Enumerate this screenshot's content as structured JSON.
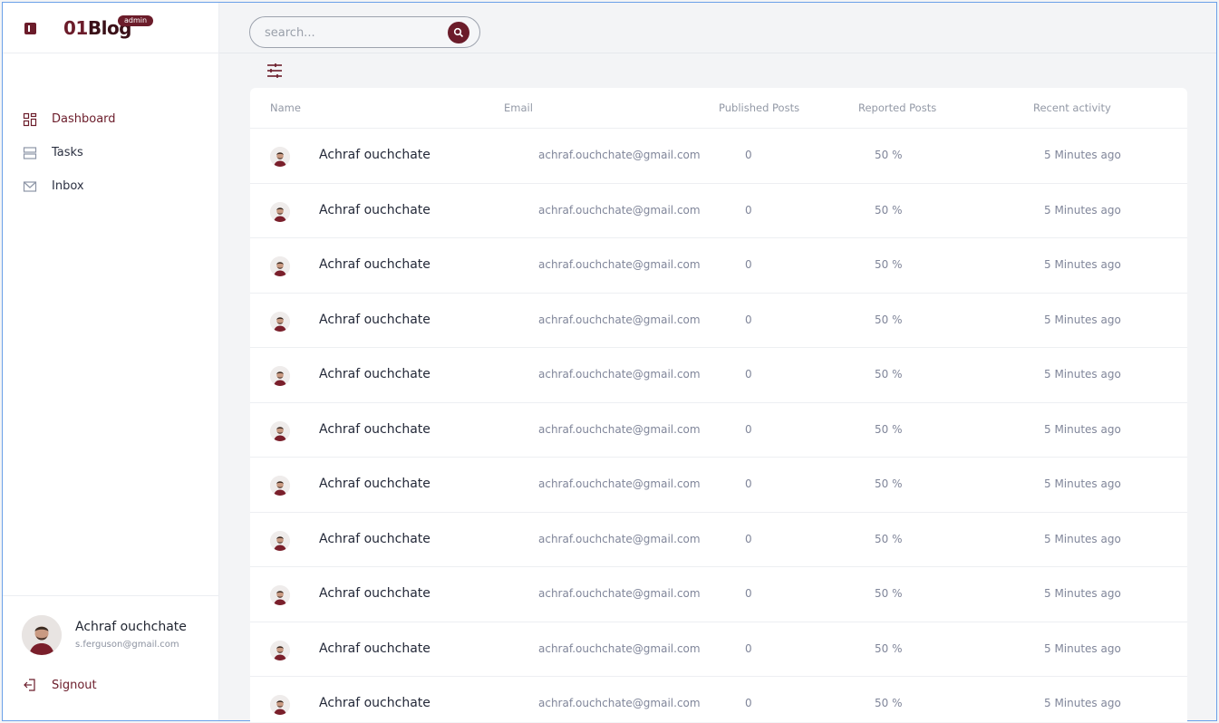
{
  "brand": {
    "logo_strong": "01",
    "logo_rest": "Blog",
    "badge": "admin"
  },
  "sidebar": {
    "items": [
      {
        "label": "Dashboard",
        "icon": "dashboard-icon"
      },
      {
        "label": "Tasks",
        "icon": "tasks-icon"
      },
      {
        "label": "Inbox",
        "icon": "inbox-icon"
      }
    ]
  },
  "user": {
    "name": "Achraf ouchchate",
    "email": "s.ferguson@gmail.com"
  },
  "signout": {
    "label": "Signout"
  },
  "search": {
    "placeholder": "search..."
  },
  "table": {
    "headers": [
      "Name",
      "Email",
      "Published Posts",
      "Reported Posts",
      "Recent activity"
    ],
    "rows": [
      {
        "name": "Achraf ouchchate",
        "email": "achraf.ouchchate@gmail.com",
        "published": "0",
        "reported": "50 %",
        "activity": "5 Minutes ago"
      },
      {
        "name": "Achraf ouchchate",
        "email": "achraf.ouchchate@gmail.com",
        "published": "0",
        "reported": "50 %",
        "activity": "5 Minutes ago"
      },
      {
        "name": "Achraf ouchchate",
        "email": "achraf.ouchchate@gmail.com",
        "published": "0",
        "reported": "50 %",
        "activity": "5 Minutes ago"
      },
      {
        "name": "Achraf ouchchate",
        "email": "achraf.ouchchate@gmail.com",
        "published": "0",
        "reported": "50 %",
        "activity": "5 Minutes ago"
      },
      {
        "name": "Achraf ouchchate",
        "email": "achraf.ouchchate@gmail.com",
        "published": "0",
        "reported": "50 %",
        "activity": "5 Minutes ago"
      },
      {
        "name": "Achraf ouchchate",
        "email": "achraf.ouchchate@gmail.com",
        "published": "0",
        "reported": "50 %",
        "activity": "5 Minutes ago"
      },
      {
        "name": "Achraf ouchchate",
        "email": "achraf.ouchchate@gmail.com",
        "published": "0",
        "reported": "50 %",
        "activity": "5 Minutes ago"
      },
      {
        "name": "Achraf ouchchate",
        "email": "achraf.ouchchate@gmail.com",
        "published": "0",
        "reported": "50 %",
        "activity": "5 Minutes ago"
      },
      {
        "name": "Achraf ouchchate",
        "email": "achraf.ouchchate@gmail.com",
        "published": "0",
        "reported": "50 %",
        "activity": "5 Minutes ago"
      },
      {
        "name": "Achraf ouchchate",
        "email": "achraf.ouchchate@gmail.com",
        "published": "0",
        "reported": "50 %",
        "activity": "5 Minutes ago"
      },
      {
        "name": "Achraf ouchchate",
        "email": "achraf.ouchchate@gmail.com",
        "published": "0",
        "reported": "50 %",
        "activity": "5 Minutes ago"
      }
    ]
  },
  "colors": {
    "accent": "#6b1c2a",
    "background": "#f3f4f6"
  }
}
